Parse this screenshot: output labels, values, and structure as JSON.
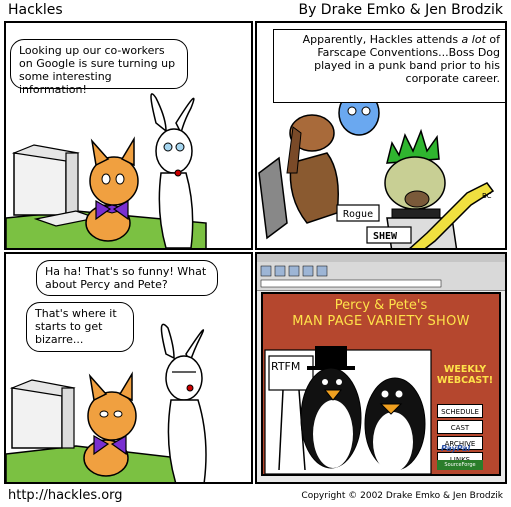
{
  "header": {
    "title": "Hackles",
    "authors": "By Drake Emko & Jen Brodzik"
  },
  "footer": {
    "url": "http://hackles.org",
    "copyright": "Copyright © 2002 Drake Emko & Jen Brodzik"
  },
  "panel1": {
    "bubble": "Looking up our co-workers on Google is sure turning up some interesting information!"
  },
  "panel2": {
    "caption_line1": "Apparently, Hackles attends ",
    "caption_emph": "a lot",
    "caption_line1b": " of",
    "caption_rest": "Farscape Conventions...Boss Dog played in a punk band prior to his corporate career.",
    "sign1": "Rogue",
    "sign2": "SHEW",
    "guitar_text": "BC"
  },
  "panel3": {
    "bubble1": "Ha ha! That's so funny! What about Percy and Pete?",
    "bubble2": "That's where it starts to get bizarre..."
  },
  "panel4": {
    "site_title1": "Percy & Pete's",
    "site_title2": "MAN PAGE VARIETY SHOW",
    "weekly": "WEEKLY WEBCAST!",
    "nav": [
      "SCHEDULE",
      "CAST",
      "ARCHIVE",
      "LINKS"
    ],
    "paypal": "PayPal",
    "sourceforge": "SourceForge",
    "rtfm": "RTFM"
  },
  "colors": {
    "cat": "#f0a040",
    "bow": "#7a2fd0",
    "desk": "#7bc142",
    "site_bg": "#b5472e",
    "site_text": "#ffe24a",
    "mohawk": "#2fb52f"
  }
}
